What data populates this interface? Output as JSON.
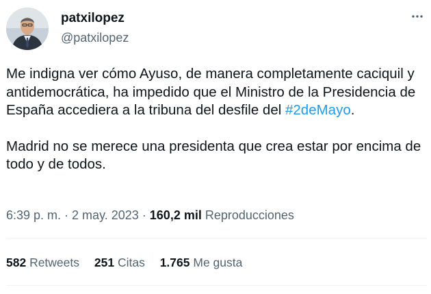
{
  "author": {
    "display_name": "patxilopez",
    "handle": "@patxilopez"
  },
  "more_icon": "more-horizontal-icon",
  "tweet": {
    "paragraph1_text": "Me indigna ver cómo Ayuso, de manera completamente caciquil y antidemocrática, ha impedido que el Ministro de la Presidencia de España accediera a la tribuna del desfile del ",
    "hashtag": "#2deMayo",
    "paragraph1_end": ".",
    "paragraph2": "Madrid no se merece una presidenta que crea estar por encima de todo y de todos."
  },
  "meta": {
    "time": "6:39 p. m.",
    "sep1": " · ",
    "date": "2 may. 2023",
    "sep2": " · ",
    "views_count": "160,2 mil",
    "views_label": " Reproducciones"
  },
  "stats": {
    "retweets_count": "582",
    "retweets_label": " Retweets",
    "quotes_count": "251",
    "quotes_label": " Citas",
    "likes_count": "1.765",
    "likes_label": " Me gusta"
  },
  "colors": {
    "link": "#1d9bf0",
    "secondary_text": "#536471",
    "divider": "#eff3f4"
  }
}
